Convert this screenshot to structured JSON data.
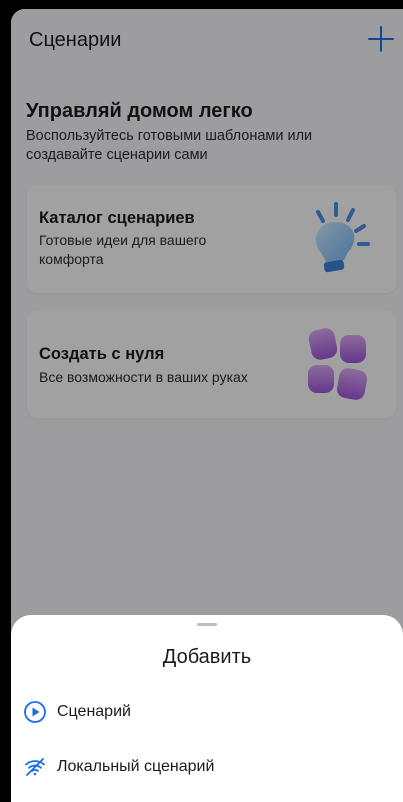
{
  "header": {
    "title": "Сценарии",
    "add_icon": "plus-icon",
    "accent": "#1a6fe3"
  },
  "promo": {
    "title": "Управляй домом легко",
    "subtitle": "Воспользуйтесь готовыми шаблонами или создавайте сценарии сами"
  },
  "cards": [
    {
      "title": "Каталог сценариев",
      "description": "Готовые идеи для вашего комфорта",
      "illustration": "lightbulb-icon"
    },
    {
      "title": "Создать с нуля",
      "description": "Все возможности в ваших руках",
      "illustration": "tiles-icon"
    }
  ],
  "sheet": {
    "title": "Добавить",
    "options": [
      {
        "label": "Сценарий",
        "icon": "play-circle-icon"
      },
      {
        "label": "Локальный сценарий",
        "icon": "wifi-off-icon"
      }
    ]
  }
}
